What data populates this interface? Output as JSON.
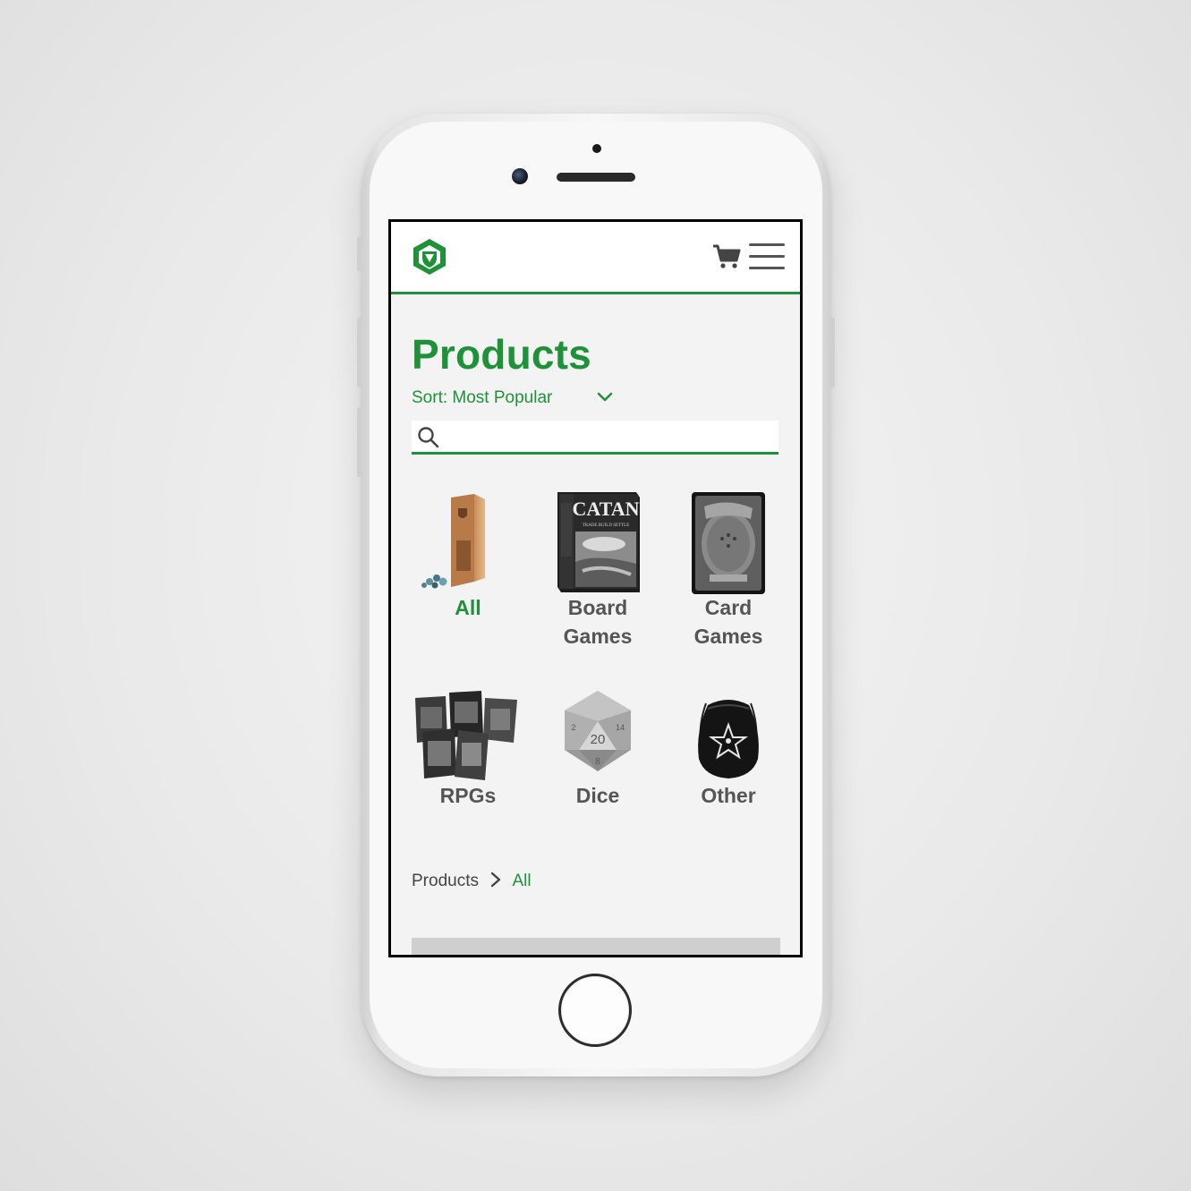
{
  "header": {
    "logo_icon": "hexagon-shield-logo",
    "cart_icon": "shopping-cart-icon",
    "menu_icon": "hamburger-menu-icon",
    "accent_color": "#1e9139"
  },
  "main": {
    "title": "Products",
    "sort_label": "Sort: Most Popular",
    "search": {
      "value": "",
      "placeholder": ""
    }
  },
  "categories": [
    {
      "label": "All",
      "image": "dice-tower-image",
      "active": true
    },
    {
      "label": "Board\nGames",
      "image": "catan-box-image",
      "active": false
    },
    {
      "label": "Card\nGames",
      "image": "magic-card-image",
      "active": false
    },
    {
      "label": "RPGs",
      "image": "rpg-books-image",
      "active": false
    },
    {
      "label": "Dice",
      "image": "d20-die-image",
      "active": false
    },
    {
      "label": "Other",
      "image": "dice-bag-image",
      "active": false
    }
  ],
  "breadcrumb": {
    "root": "Products",
    "current": "All"
  },
  "images": {
    "catan_title": "CATAN",
    "catan_subtitle": "TRADE BUILD SETTLE",
    "d20_face": "20",
    "d20_lower": "8",
    "d20_left": "2",
    "d20_right": "14"
  }
}
